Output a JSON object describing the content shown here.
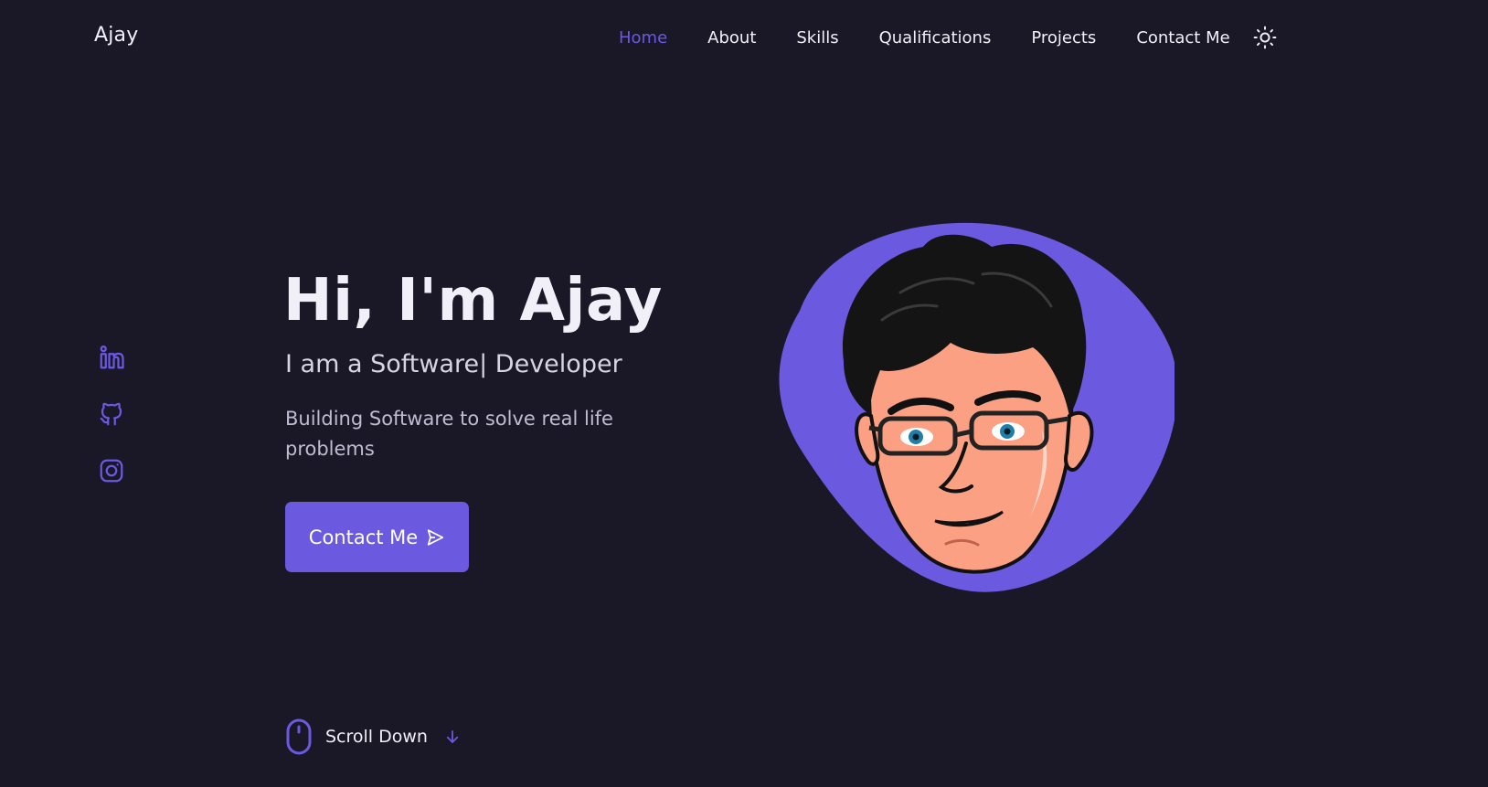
{
  "header": {
    "logo": "Ajay",
    "nav": [
      {
        "label": "Home",
        "active": true
      },
      {
        "label": "About"
      },
      {
        "label": "Skills"
      },
      {
        "label": "Qualifications"
      },
      {
        "label": "Projects"
      },
      {
        "label": "Contact Me"
      }
    ],
    "theme_icon": "sun-icon"
  },
  "social": [
    {
      "name": "linkedin",
      "icon": "linkedin-icon"
    },
    {
      "name": "github",
      "icon": "github-icon"
    },
    {
      "name": "instagram",
      "icon": "instagram-icon"
    }
  ],
  "hero": {
    "title": "Hi, I'm Ajay",
    "subtitle": "I am a Software| Developer",
    "description": "Building Software to solve real life problems",
    "button_label": "Contact Me",
    "avatar_icon": "cartoon-avatar"
  },
  "scroll": {
    "label": "Scroll Down"
  },
  "colors": {
    "background": "#1a1727",
    "accent": "#6b59e0",
    "text": "#f1eff8",
    "muted": "#c0bcd0"
  }
}
